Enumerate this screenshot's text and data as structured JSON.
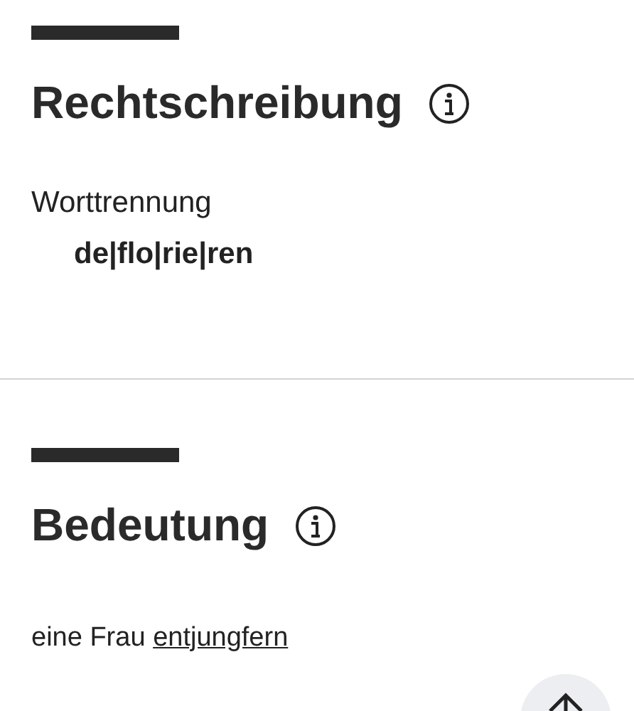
{
  "sections": [
    {
      "heading": "Rechtschreibung",
      "kind": "spelling",
      "label": "Worttrennung",
      "value": "de|flo|rie|ren"
    },
    {
      "heading": "Bedeutung",
      "kind": "meaning",
      "text": "eine Frau",
      "link": "entjungfern"
    }
  ]
}
